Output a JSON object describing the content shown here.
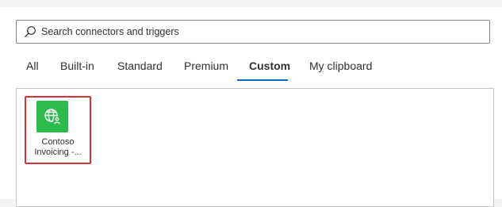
{
  "search": {
    "placeholder": "Search connectors and triggers",
    "icon": "search-icon"
  },
  "tabs": [
    {
      "label": "All",
      "active": false
    },
    {
      "label": "Built-in",
      "active": false
    },
    {
      "label": "Standard",
      "active": false
    },
    {
      "label": "Premium",
      "active": false
    },
    {
      "label": "Custom",
      "active": true
    },
    {
      "label": "My clipboard",
      "active": false
    }
  ],
  "colors": {
    "accent": "#0f6cbd",
    "selection_highlight": "#d13438",
    "connector_badge": "#2dbb4e"
  },
  "connectors": [
    {
      "name_line1": "Contoso",
      "name_line2": "Invoicing -...",
      "icon": "globe-user-icon"
    }
  ]
}
